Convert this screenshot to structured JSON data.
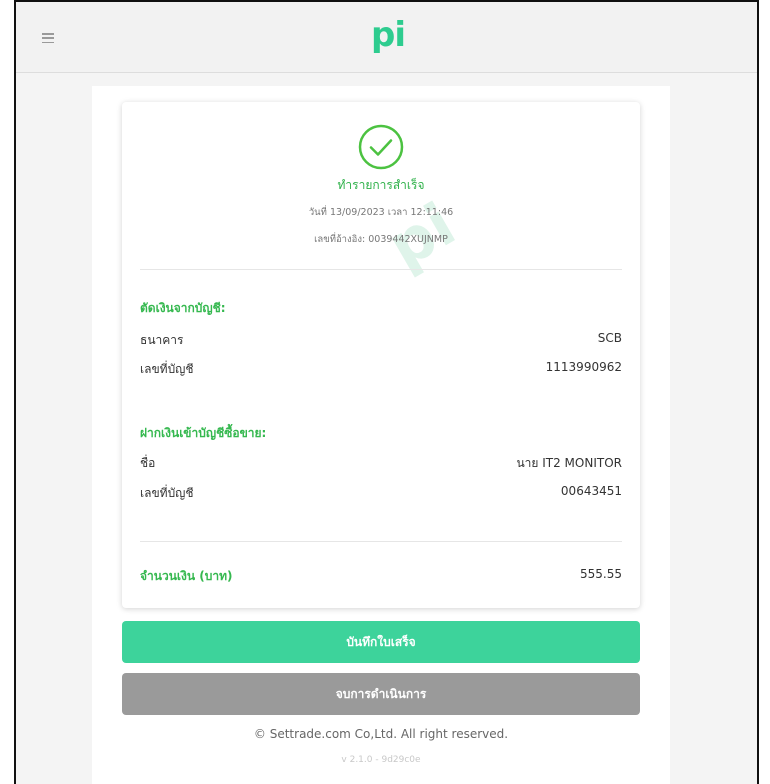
{
  "header": {
    "menu_icon": "hamburger-icon",
    "logo": "pi"
  },
  "receipt": {
    "status_icon": "check-circle-icon",
    "status": "ทำรายการสำเร็จ",
    "date_time": "วันที่ 13/09/2023 เวลา 12:11:46",
    "reference": "เลขที่อ้างอิง: 0039442XUJNMP",
    "watermark": "pi",
    "from_section": {
      "title": "ตัดเงินจากบัญชี:",
      "rows": [
        {
          "label": "ธนาคาร",
          "value": "SCB"
        },
        {
          "label": "เลขที่บัญชี",
          "value": "1113990962"
        }
      ]
    },
    "to_section": {
      "title": "ฝากเงินเข้าบัญชีซื้อขาย:",
      "rows": [
        {
          "label": "ชื่อ",
          "value": "นาย IT2 MONITOR"
        },
        {
          "label": "เลขที่บัญชี",
          "value": "00643451"
        }
      ]
    },
    "amount": {
      "label": "จำนวนเงิน (บาท)",
      "value": "555.55"
    }
  },
  "actions": {
    "save_label": "บันทึกใบเสร็จ",
    "end_label": "จบการดำเนินการ"
  },
  "footer": {
    "copyright": "© Settrade.com Co,Ltd. All right reserved.",
    "version": "v 2.1.0 - 9d29c0e"
  },
  "colors": {
    "accent": "#3dd39b",
    "success": "#35b84f",
    "disabled": "#9a9a9a"
  }
}
